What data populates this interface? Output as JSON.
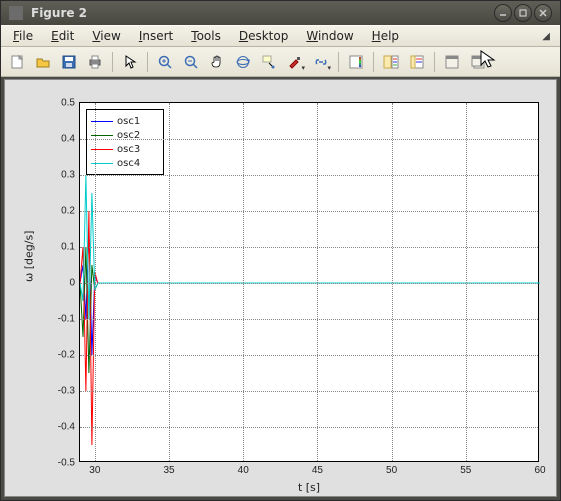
{
  "window": {
    "title": "Figure 2",
    "min_tip": "Minimize",
    "max_tip": "Maximize",
    "close_tip": "Close"
  },
  "menu": {
    "file": {
      "label": "File",
      "ul": "F"
    },
    "edit": {
      "label": "Edit",
      "ul": "E"
    },
    "view": {
      "label": "View",
      "ul": "V"
    },
    "insert": {
      "label": "Insert",
      "ul": "I"
    },
    "tools": {
      "label": "Tools",
      "ul": "T"
    },
    "desktop": {
      "label": "Desktop",
      "ul": "D"
    },
    "window": {
      "label": "Window",
      "ul": "W"
    },
    "help": {
      "label": "Help",
      "ul": "H"
    }
  },
  "toolbar": {
    "items": [
      {
        "id": "new-figure",
        "icon": "new"
      },
      {
        "id": "open-file",
        "icon": "open"
      },
      {
        "id": "save-figure",
        "icon": "save"
      },
      {
        "id": "print-figure",
        "icon": "print"
      },
      {
        "id": "sep"
      },
      {
        "id": "edit-plot",
        "icon": "arrow"
      },
      {
        "id": "sep"
      },
      {
        "id": "zoom-in",
        "icon": "zoomin"
      },
      {
        "id": "zoom-out",
        "icon": "zoomout"
      },
      {
        "id": "pan",
        "icon": "hand"
      },
      {
        "id": "rotate-3d",
        "icon": "rotate"
      },
      {
        "id": "data-cursor",
        "icon": "datacursor"
      },
      {
        "id": "brush",
        "icon": "brush",
        "sub": true
      },
      {
        "id": "link-plot",
        "icon": "link",
        "sub": true
      },
      {
        "id": "sep"
      },
      {
        "id": "insert-colorbar",
        "icon": "colorbar"
      },
      {
        "id": "sep"
      },
      {
        "id": "insert-legend",
        "icon": "legend"
      },
      {
        "id": "hide-plot-tools",
        "icon": "showtools"
      },
      {
        "id": "sep"
      },
      {
        "id": "dock-figure",
        "icon": "dock"
      },
      {
        "id": "undock-figure",
        "icon": "undock"
      }
    ]
  },
  "chart_data": {
    "type": "line",
    "title": "",
    "xlabel": "t [s]",
    "ylabel": "ω [deg/s]",
    "xlim": [
      29,
      60
    ],
    "ylim": [
      -0.5,
      0.5
    ],
    "xticks": [
      30,
      35,
      40,
      45,
      50,
      55,
      60
    ],
    "yticks": [
      -0.5,
      -0.4,
      -0.3,
      -0.2,
      -0.1,
      0,
      0.1,
      0.2,
      0.3,
      0.4,
      0.5
    ],
    "grid": true,
    "legend_position": "northwest",
    "series": [
      {
        "name": "osc1",
        "color": "#0000ff",
        "x": [
          29.0,
          29.2,
          29.4,
          29.6,
          29.8,
          30.0,
          30.2,
          60.0
        ],
        "y": [
          0.0,
          0.05,
          -0.1,
          0.15,
          -0.2,
          0.02,
          0.0,
          0.0
        ]
      },
      {
        "name": "osc2",
        "color": "#006400",
        "x": [
          29.0,
          29.2,
          29.4,
          29.6,
          29.8,
          30.0,
          30.2,
          60.0
        ],
        "y": [
          0.0,
          -0.15,
          0.1,
          -0.25,
          0.05,
          -0.02,
          0.0,
          0.0
        ]
      },
      {
        "name": "osc3",
        "color": "#ff0000",
        "x": [
          29.0,
          29.2,
          29.4,
          29.6,
          29.8,
          30.0,
          30.2,
          60.0
        ],
        "y": [
          0.0,
          0.1,
          -0.3,
          0.2,
          -0.45,
          0.03,
          0.0,
          0.0
        ]
      },
      {
        "name": "osc4",
        "color": "#00cccc",
        "x": [
          29.0,
          29.2,
          29.4,
          29.6,
          29.8,
          30.0,
          30.2,
          60.0
        ],
        "y": [
          0.0,
          -0.05,
          0.3,
          -0.1,
          0.25,
          -0.02,
          0.0,
          0.0
        ]
      }
    ]
  }
}
